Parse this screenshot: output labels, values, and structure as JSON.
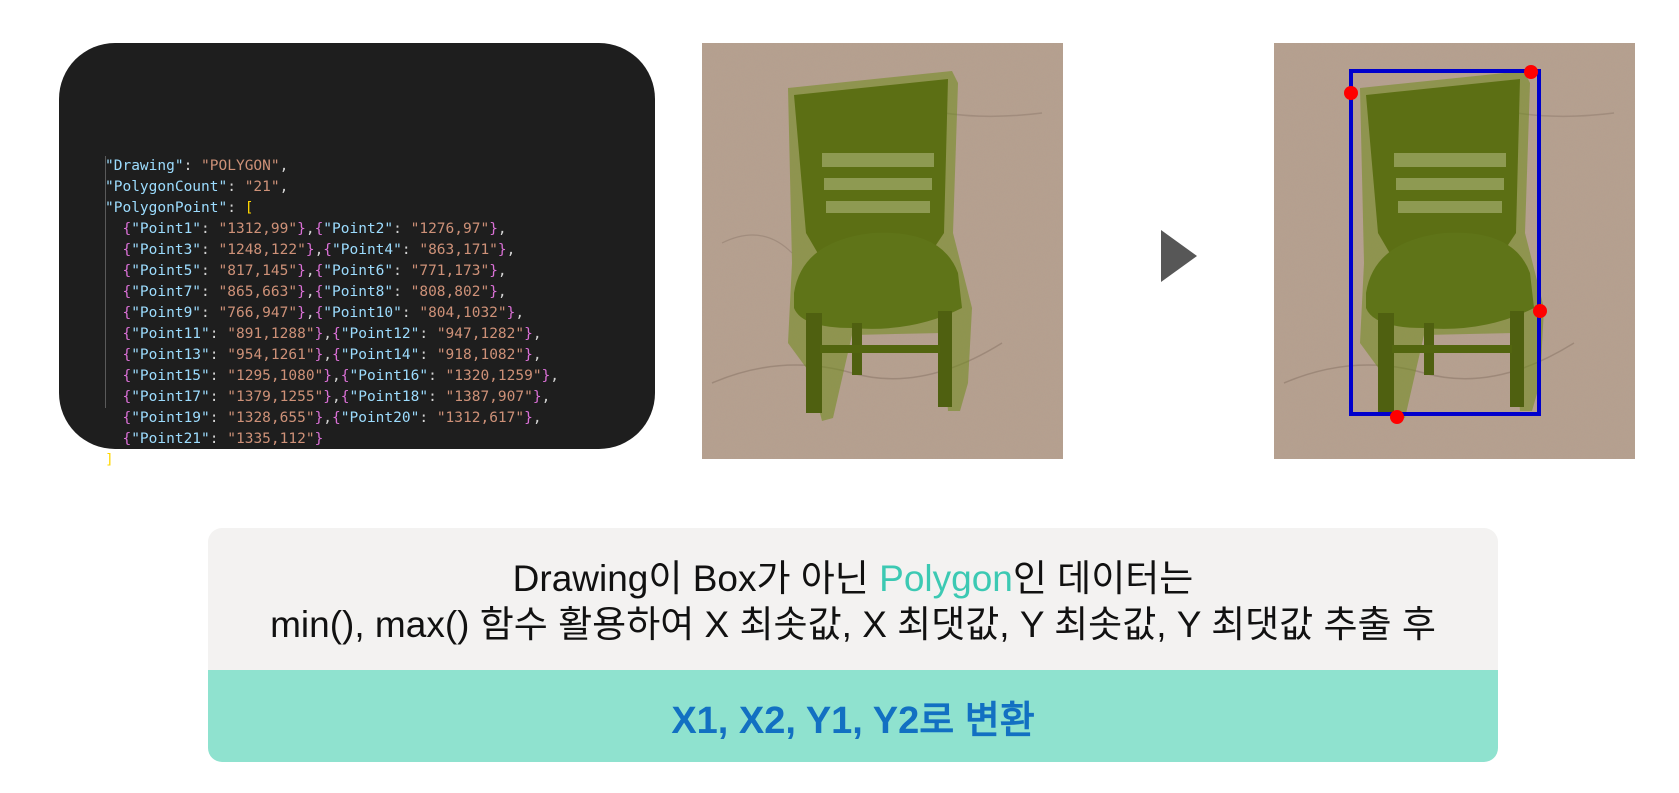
{
  "code": {
    "lines": [
      "\"Drawing\": \"POLYGON\",",
      "\"PolygonCount\": \"21\",",
      "\"PolygonPoint\": [",
      "  {\"Point1\": \"1312,99\"},{\"Point2\": \"1276,97\"},",
      "  {\"Point3\": \"1248,122\"},{\"Point4\": \"863,171\"},",
      "  {\"Point5\": \"817,145\"},{\"Point6\": \"771,173\"},",
      "  {\"Point7\": \"865,663\"},{\"Point8\": \"808,802\"},",
      "  {\"Point9\": \"766,947\"},{\"Point10\": \"804,1032\"},",
      "  {\"Point11\": \"891,1288\"},{\"Point12\": \"947,1282\"},",
      "  {\"Point13\": \"954,1261\"},{\"Point14\": \"918,1082\"},",
      "  {\"Point15\": \"1295,1080\"},{\"Point16\": \"1320,1259\"},",
      "  {\"Point17\": \"1379,1255\"},{\"Point18\": \"1387,907\"},",
      "  {\"Point19\": \"1328,655\"},{\"Point20\": \"1312,617\"},",
      "  {\"Point21\": \"1335,112\"}",
      "]"
    ]
  },
  "caption": {
    "line1_a": "Drawing이 Box가 아닌 ",
    "line1_highlight": "Polygon",
    "line1_b": "인 데이터는",
    "line2": "min(), max() 함수 활용하여 X 최솟값, X 최댓값, Y 최솟값, Y 최댓값 추출 후",
    "result": "X1, X2, Y1, Y2로 변환"
  },
  "colors": {
    "code_bg": "#1e1e1e",
    "highlight": "#3cc9b3",
    "result_bg": "#8fe2cf",
    "result_text": "#1270c2",
    "bbox": "#0000cc",
    "bbox_points": "#ff0000",
    "polygon_fill": "#5f7a10"
  },
  "icons": {
    "arrow": "play-triangle-icon"
  }
}
